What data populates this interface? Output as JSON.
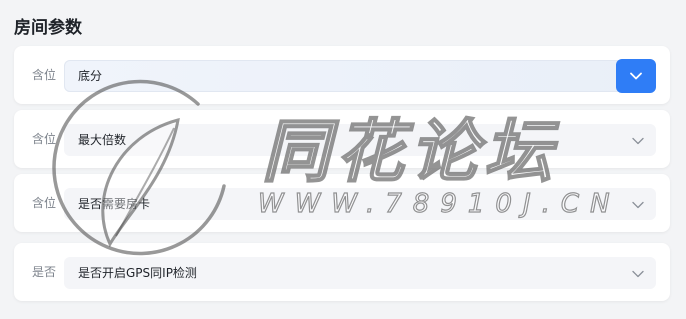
{
  "section": {
    "title": "房间参数"
  },
  "rows": [
    {
      "label": "含位",
      "value": "底分",
      "active": true
    },
    {
      "label": "含位",
      "value": "最大倍数",
      "active": false
    },
    {
      "label": "含位",
      "value": "是否需要房卡",
      "active": false
    },
    {
      "label": "是否",
      "value": "是否开启GPS同IP检测",
      "active": false
    }
  ],
  "watermark": {
    "title": "同花论坛",
    "url": "WWW.78910J.CN"
  },
  "colors": {
    "accent": "#2f7df6",
    "background": "#f3f4f6",
    "card": "#ffffff",
    "label": "#7d838c"
  },
  "icons": {
    "dropdown": "chevron-down-icon"
  }
}
